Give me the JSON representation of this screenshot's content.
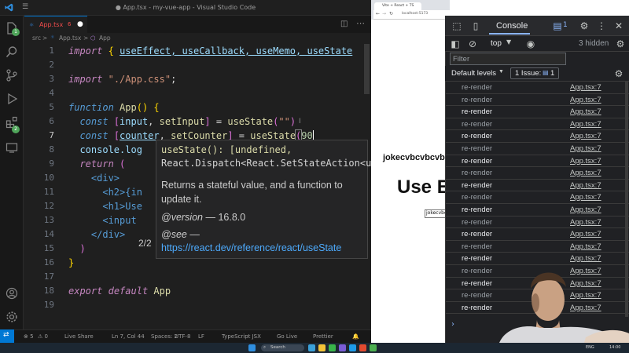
{
  "vscode": {
    "window_title": "● App.tsx - my-vue-app - Visual Studio Code",
    "tab": {
      "label": "App.tsx",
      "problems": "6"
    },
    "breadcrumb": {
      "folder": "src",
      "sep": ">",
      "file": "App.tsx",
      "symbol": "App"
    },
    "activity_badges": {
      "explorer": "1",
      "extensions": "2"
    },
    "line_numbers": [
      "1",
      "2",
      "3",
      "4",
      "5",
      "6",
      "7",
      "8",
      "9",
      "10",
      "11",
      "12",
      "13",
      "14",
      "15",
      "16",
      "17",
      "18",
      "19"
    ],
    "code": {
      "l1_import": "import",
      "l1_rest": "useEffect, useCallback, useMemo, useState",
      "l3_import": "import",
      "l3_str": "\"./App.css\"",
      "l5_function": "function",
      "l5_name": "App",
      "l5_rest": "() {",
      "l6_const": "const",
      "l6_a": "input",
      "l6_b": "setInput",
      "l6_call": "useState",
      "l6_arg": "\"\"",
      "l7_const": "const",
      "l7_a": "counter",
      "l7_b": "setCounter",
      "l7_call": "useState",
      "l7_arg": "90",
      "l8": "console.log",
      "l9_return": "return",
      "l10": "<div>",
      "l11": "<h2>{in",
      "l12": "<h1>Use",
      "l13": "<input",
      "l14": "</div>",
      "l15": ")",
      "l16": "}",
      "l18_export": "export",
      "l18_default": "default",
      "l18_name": "App"
    },
    "hover": {
      "sig_line1": "useState(): [undefined,",
      "sig_line2": "React.Dispatch<React.SetStateAction<u",
      "desc_line1": "Returns a stateful value, and a function to",
      "desc_line2": "update it.",
      "version_tag": "@version",
      "version_val": "— 16.8.0",
      "see_tag": "@see",
      "see_dash": "—",
      "link": "https://react.dev/reference/react/useState",
      "overload": "2/2"
    },
    "status": {
      "errors": "⊗ 5",
      "warnings": "⚠ 0",
      "live_share": "Live Share",
      "position": "Ln 7, Col 44",
      "spaces": "Spaces: 2",
      "encoding": "UTF-8",
      "eol": "LF",
      "language": "TypeScript JSX",
      "go_live": "Go Live",
      "prettier": "Prettier"
    }
  },
  "browser": {
    "tab_title": "Vite + React + TS",
    "url": "localhost:5173",
    "heading2": "jokecvbcvbcvb",
    "heading1": "Use E",
    "input_value": "jokecvbcvbcvb"
  },
  "devtools": {
    "tab_console": "Console",
    "issues_badge": "1",
    "context": "top",
    "hidden": "3 hidden",
    "filter_placeholder": "Filter",
    "default_levels": "Default levels",
    "issue_label": "1 Issue:",
    "issue_count": "1",
    "prompt": "›",
    "logs": [
      {
        "msg": "re-render",
        "src": "App.tsx:7",
        "dim": true
      },
      {
        "msg": "re-render",
        "src": "App.tsx:7",
        "dim": true
      },
      {
        "msg": "re-render",
        "src": "App.tsx:7",
        "dim": false
      },
      {
        "msg": "re-render",
        "src": "App.tsx:7",
        "dim": true
      },
      {
        "msg": "re-render",
        "src": "App.tsx:7",
        "dim": false
      },
      {
        "msg": "re-render",
        "src": "App.tsx:7",
        "dim": true
      },
      {
        "msg": "re-render",
        "src": "App.tsx:7",
        "dim": false
      },
      {
        "msg": "re-render",
        "src": "App.tsx:7",
        "dim": true
      },
      {
        "msg": "re-render",
        "src": "App.tsx:7",
        "dim": false
      },
      {
        "msg": "re-render",
        "src": "App.tsx:7",
        "dim": true
      },
      {
        "msg": "re-render",
        "src": "App.tsx:7",
        "dim": false
      },
      {
        "msg": "re-render",
        "src": "App.tsx:7",
        "dim": true
      },
      {
        "msg": "re-render",
        "src": "App.tsx:7",
        "dim": false
      },
      {
        "msg": "re-render",
        "src": "App.tsx:7",
        "dim": true
      },
      {
        "msg": "re-render",
        "src": "App.tsx:7",
        "dim": false
      },
      {
        "msg": "re-render",
        "src": "App.tsx:7",
        "dim": true
      },
      {
        "msg": "re-render",
        "src": "App.tsx:7",
        "dim": false
      },
      {
        "msg": "re-render",
        "src": "App.tsx:7",
        "dim": true
      },
      {
        "msg": "re-render",
        "src": "App.tsx:7",
        "dim": false
      }
    ]
  },
  "taskbar": {
    "search": "Search",
    "tray_lang": "ENG",
    "tray_time": "14:00"
  },
  "colors": {
    "accent": "#0078d4",
    "devtools_link": "#8ab4f8"
  }
}
